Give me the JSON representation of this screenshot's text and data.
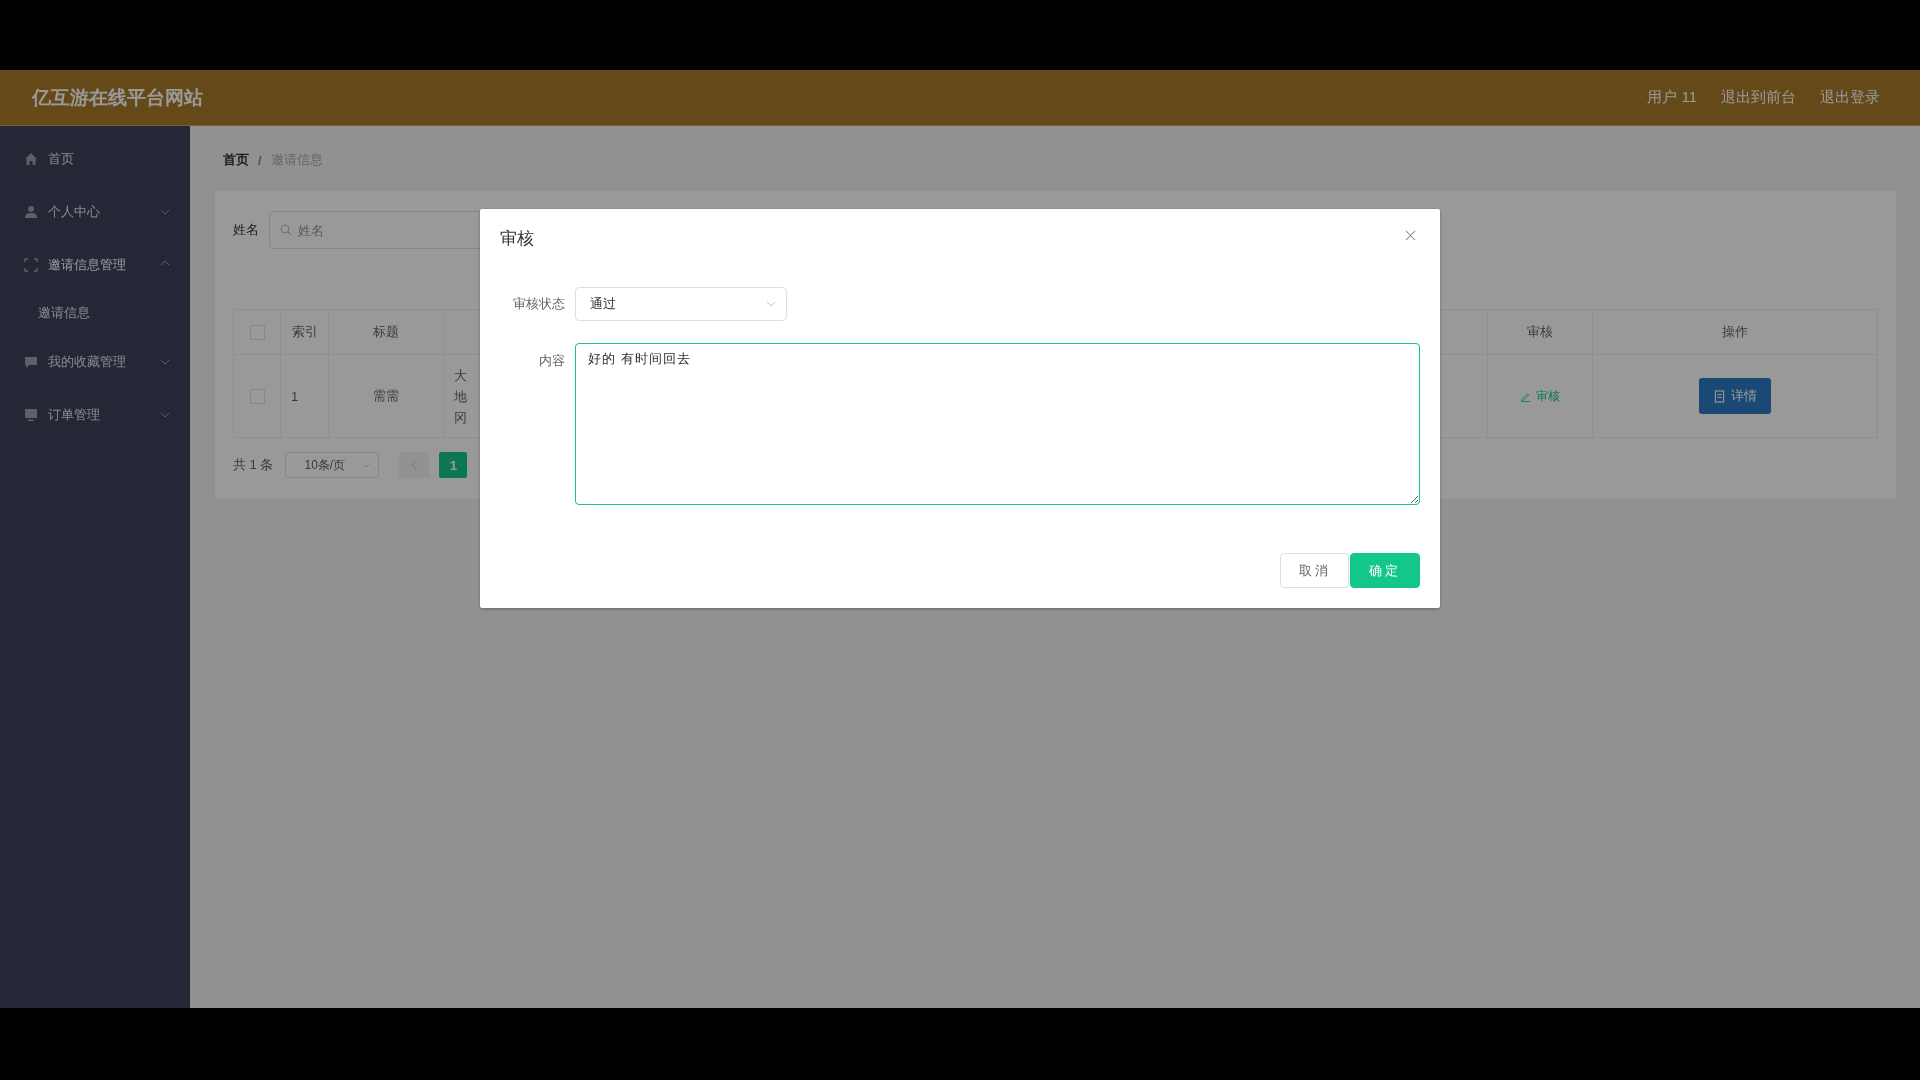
{
  "header": {
    "title": "亿互游在线平台网站",
    "links": [
      "用户 11",
      "退出到前台",
      "退出登录"
    ]
  },
  "sidebar": {
    "items": [
      {
        "label": "首页",
        "kind": "link",
        "expanded": false
      },
      {
        "label": "个人中心",
        "kind": "submenu",
        "expanded": false
      },
      {
        "label": "邀请信息管理",
        "kind": "submenu",
        "expanded": true,
        "children": [
          {
            "label": "邀请信息"
          }
        ]
      },
      {
        "label": "我的收藏管理",
        "kind": "submenu",
        "expanded": false
      },
      {
        "label": "订单管理",
        "kind": "submenu",
        "expanded": false
      }
    ]
  },
  "breadcrumb": {
    "items": [
      "首页",
      "邀请信息"
    ],
    "separator": "/"
  },
  "search": {
    "label": "姓名",
    "placeholder": "姓名"
  },
  "table": {
    "header_checked": false,
    "columns": [
      "索引",
      "标题",
      "审核",
      "操作"
    ],
    "rows": [
      {
        "checked": false,
        "index": "1",
        "title": "需需",
        "column_4": [
          "大",
          "地",
          "冈"
        ],
        "review": "审核",
        "action": "详情"
      }
    ]
  },
  "pagination": {
    "total": "共 1 条",
    "page_size": "10条/页",
    "pages": [
      {
        "label": "1",
        "selected": true
      }
    ]
  },
  "dialog": {
    "title": "审核",
    "status_label": "审核状态",
    "status_value": "通过",
    "content_label": "内容",
    "content_value": "好的 有时间回去",
    "buttons": [
      "取消",
      "确定"
    ]
  }
}
